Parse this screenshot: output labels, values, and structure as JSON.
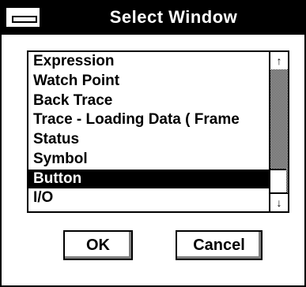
{
  "dialog": {
    "title": "Select Window",
    "system_menu_icon": "system-menu-icon"
  },
  "list": {
    "items": [
      "Expression",
      "Watch Point",
      "Back Trace",
      "Trace - Loading Data ( Frame",
      "Status",
      "Symbol",
      "Button",
      "I/O"
    ],
    "selected_index": 6
  },
  "scrollbar": {
    "up_icon": "arrow-up-icon",
    "down_icon": "arrow-down-icon",
    "position": 0.85
  },
  "buttons": {
    "ok_label": "OK",
    "cancel_label": "Cancel"
  },
  "colors": {
    "title_bar": "#000000",
    "selection": "#000000",
    "background": "#ffffff"
  }
}
